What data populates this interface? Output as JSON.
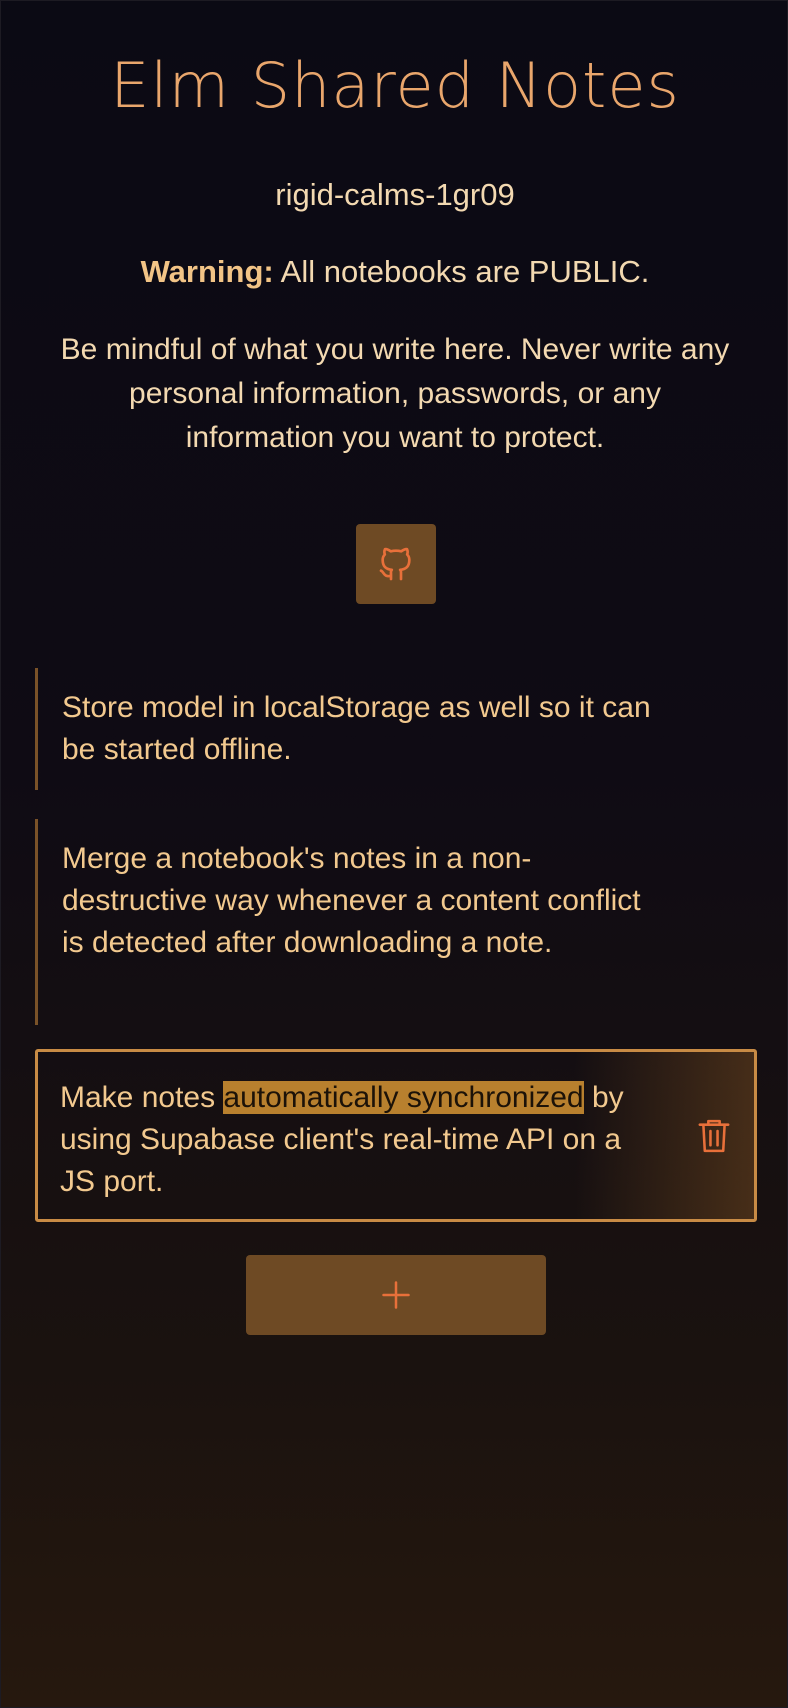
{
  "app": {
    "title": "Elm Shared Notes",
    "notebook_id": "rigid-calms-1gr09"
  },
  "warning": {
    "label": "Warning:",
    "text": " All notebooks are PUBLIC.",
    "details": "Be mindful of what you write here. Never write any personal information, passwords, or any information you want to protect."
  },
  "notes": [
    {
      "text": "Store model in localStorage as well so it can be started offline."
    },
    {
      "text": "Merge a notebook's notes in a non-destructive way whenever a content conflict is detected after downloading a note."
    },
    {
      "text_before": "Make notes ",
      "text_highlighted": "automatically synchronized",
      "text_after": " by using Supabase client's real-time API on a JS port."
    }
  ],
  "icons": {
    "github": "github-icon",
    "delete": "trash-icon",
    "add": "plus-icon"
  },
  "colors": {
    "accent": "#e9a66c",
    "button_bg": "#6e4a24",
    "icon": "#e8703a",
    "highlight": "#b8802e",
    "selected_border": "#c88b45"
  }
}
